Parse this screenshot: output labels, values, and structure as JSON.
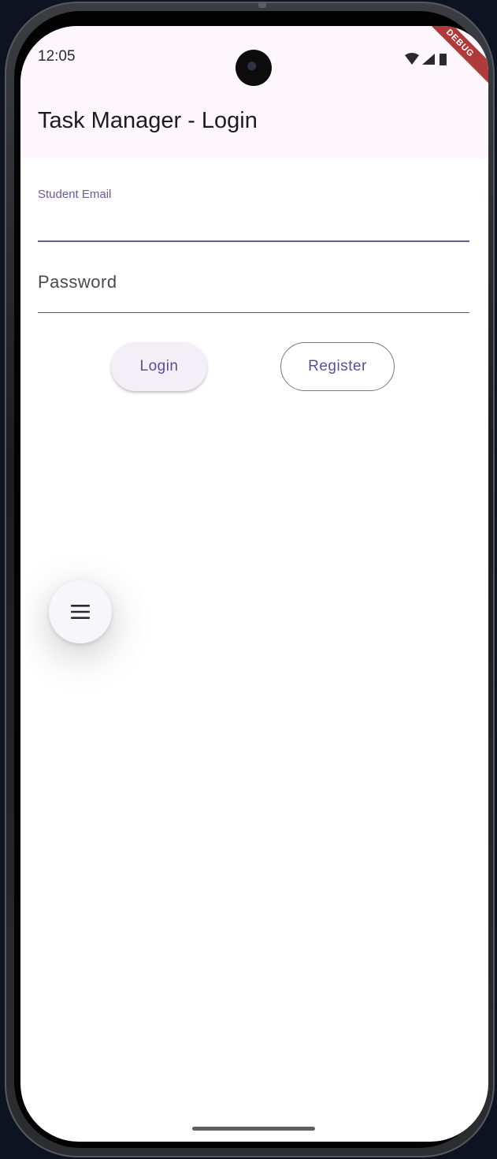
{
  "status_bar": {
    "time": "12:05",
    "icons": [
      "wifi-icon",
      "cellular-signal-icon",
      "battery-icon"
    ],
    "debug_banner": "DEBUG"
  },
  "app_bar": {
    "title": "Task Manager - Login"
  },
  "form": {
    "email": {
      "label": "Student Email",
      "value": ""
    },
    "password": {
      "placeholder": "Password",
      "value": ""
    },
    "login_label": "Login",
    "register_label": "Register"
  },
  "fab": {
    "icon": "menu-icon"
  },
  "colors": {
    "app_bar_bg": "#fdf6fc",
    "accent": "#6a5a9c",
    "button_text": "#5d4e96",
    "debug_banner": "#b03a3a"
  }
}
